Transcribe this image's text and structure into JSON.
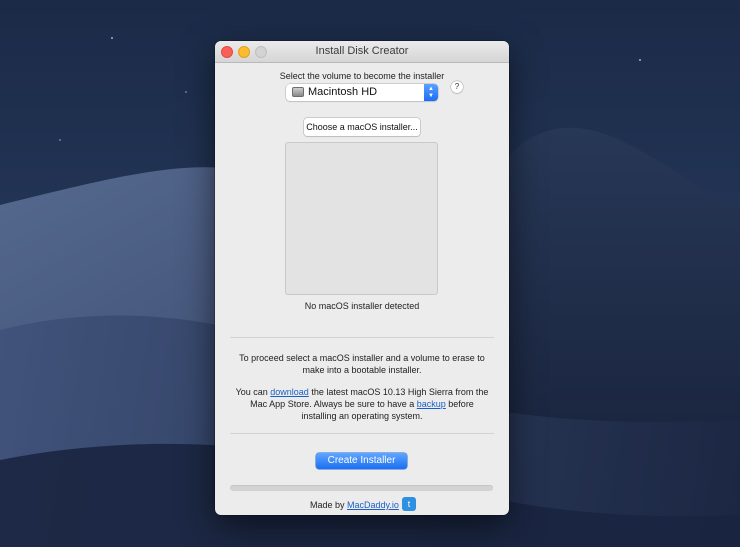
{
  "window": {
    "title": "Install Disk Creator"
  },
  "volume": {
    "label": "Select the volume to become the installer",
    "selected": "Macintosh HD",
    "help": "?"
  },
  "installer": {
    "choose_label": "Choose a macOS installer...",
    "status": "No macOS installer detected"
  },
  "info": {
    "line1": "To proceed select a macOS installer and a volume to erase to make into a bootable installer.",
    "line2_a": "You can ",
    "line2_link1": "download",
    "line2_b": " the latest macOS 10.13 High Sierra from the Mac App Store. Always be sure to have a ",
    "line2_link2": "backup",
    "line2_c": " before installing an operating system."
  },
  "actions": {
    "create_label": "Create Installer"
  },
  "progress": {
    "value": 0
  },
  "footer": {
    "prefix": "Made by ",
    "link": "MacDaddy.io"
  },
  "icons": {
    "disk": "hard-disk-icon",
    "stepper": "up-down-chevron-icon",
    "twitter": "twitter-bird-icon"
  },
  "colors": {
    "accent": "#1b6ef2",
    "link": "#1a5fc8",
    "close": "#fc5f57",
    "minimize": "#fdbc2e"
  }
}
